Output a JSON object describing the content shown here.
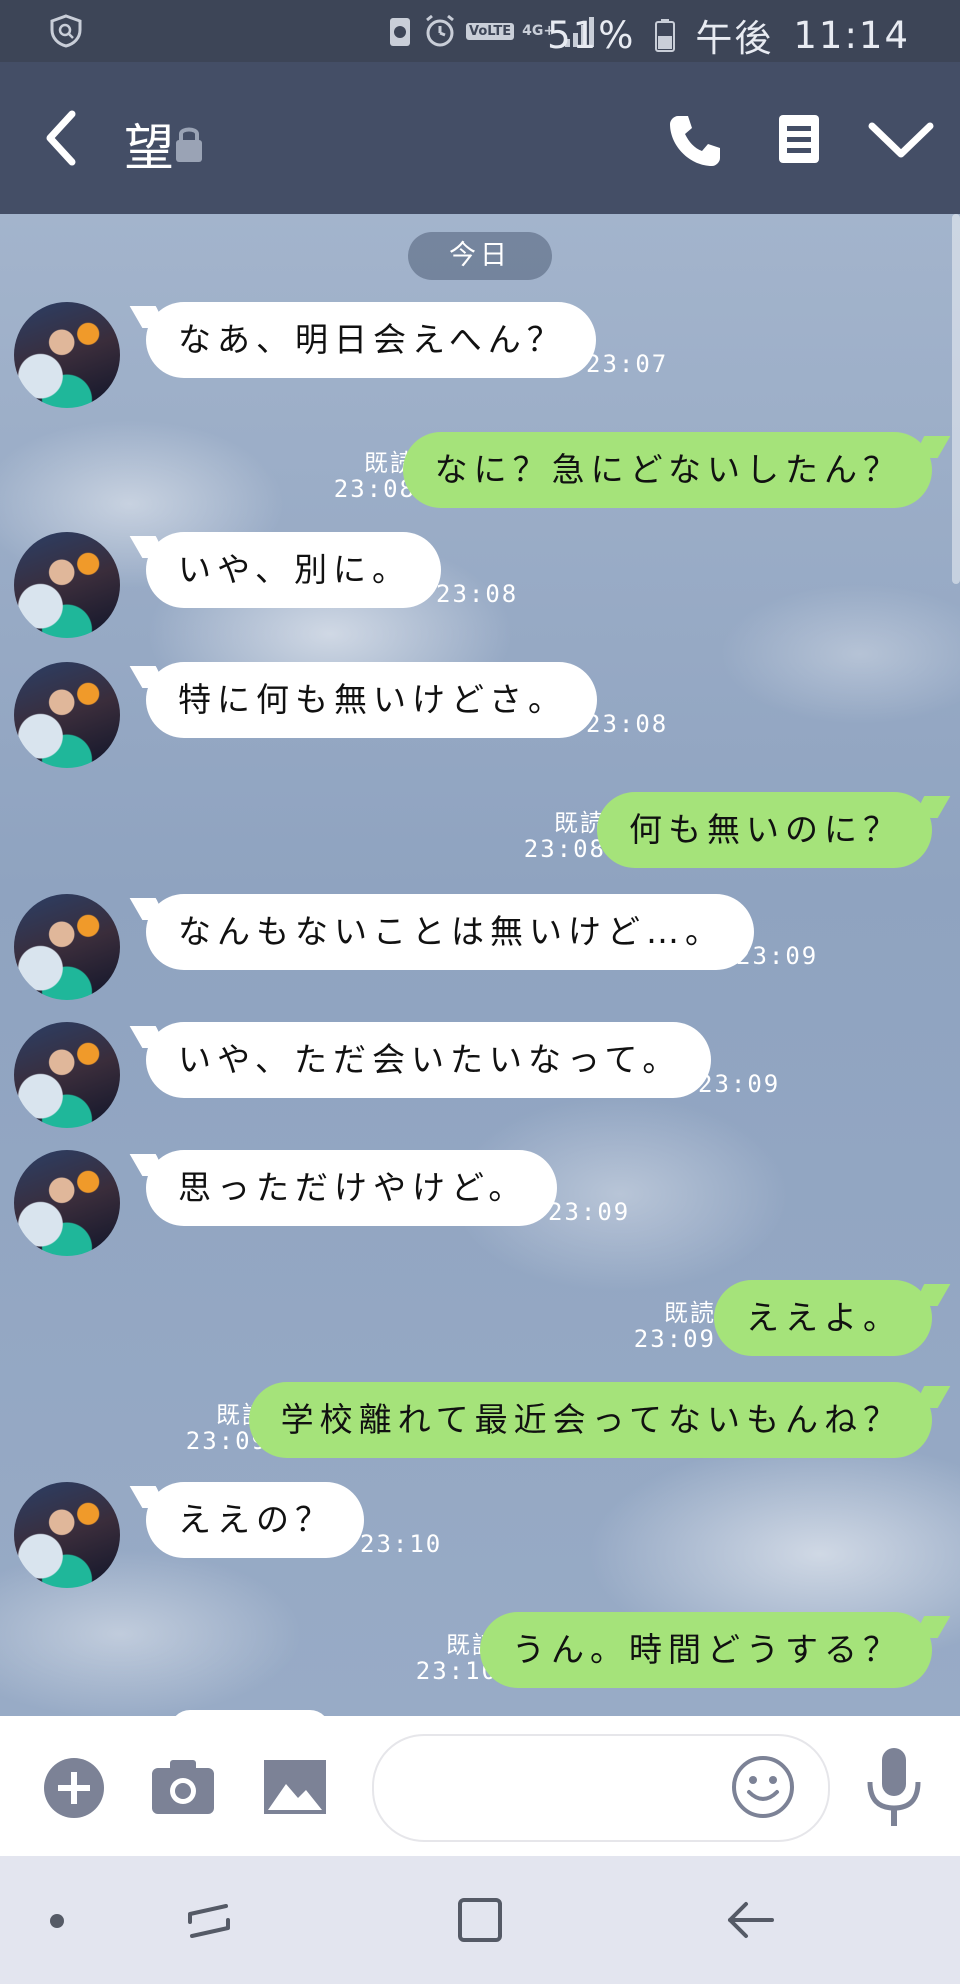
{
  "status_bar": {
    "battery_percent": "51%",
    "period": "午後",
    "time": "11:14",
    "network": "4G+",
    "volte": "VoLTE"
  },
  "header": {
    "title": "望",
    "icons": [
      "back-icon",
      "lock-icon",
      "phone-icon",
      "notes-icon",
      "dropdown-icon"
    ]
  },
  "chat": {
    "date_label": "今日",
    "read_label": "既読",
    "messages": [
      {
        "dir": "in",
        "text": "なあ、明日会えへん？",
        "time": "23:07"
      },
      {
        "dir": "out",
        "text": "なに？急にどないしたん？",
        "time": "23:08",
        "read": "既読"
      },
      {
        "dir": "in",
        "text": "いや、別に。",
        "time": "23:08"
      },
      {
        "dir": "in",
        "text": "特に何も無いけどさ。",
        "time": "23:08"
      },
      {
        "dir": "out",
        "text": "何も無いのに？",
        "time": "23:08",
        "read": "既読"
      },
      {
        "dir": "in",
        "text": "なんもないことは無いけど…。",
        "time": "23:09"
      },
      {
        "dir": "in",
        "text": "いや、ただ会いたいなって。",
        "time": "23:09"
      },
      {
        "dir": "in",
        "text": "思っただけやけど。",
        "time": "23:09"
      },
      {
        "dir": "out",
        "text": "ええよ。",
        "time": "23:09",
        "read": "既読"
      },
      {
        "dir": "out",
        "text": "学校離れて最近会ってないもんね？",
        "time": "23:09",
        "read": "既読"
      },
      {
        "dir": "in",
        "text": "ええの？",
        "time": "23:10"
      },
      {
        "dir": "out",
        "text": "うん。時間どうする？",
        "time": "23:10",
        "read": "既読"
      }
    ]
  },
  "input_bar": {
    "icons": [
      "plus-icon",
      "camera-icon",
      "image-icon",
      "emoji-icon",
      "mic-icon"
    ],
    "placeholder": ""
  },
  "colors": {
    "header_bg": "#444e66",
    "outgoing_bubble": "#a5e37a",
    "incoming_bubble": "#ffffff"
  }
}
